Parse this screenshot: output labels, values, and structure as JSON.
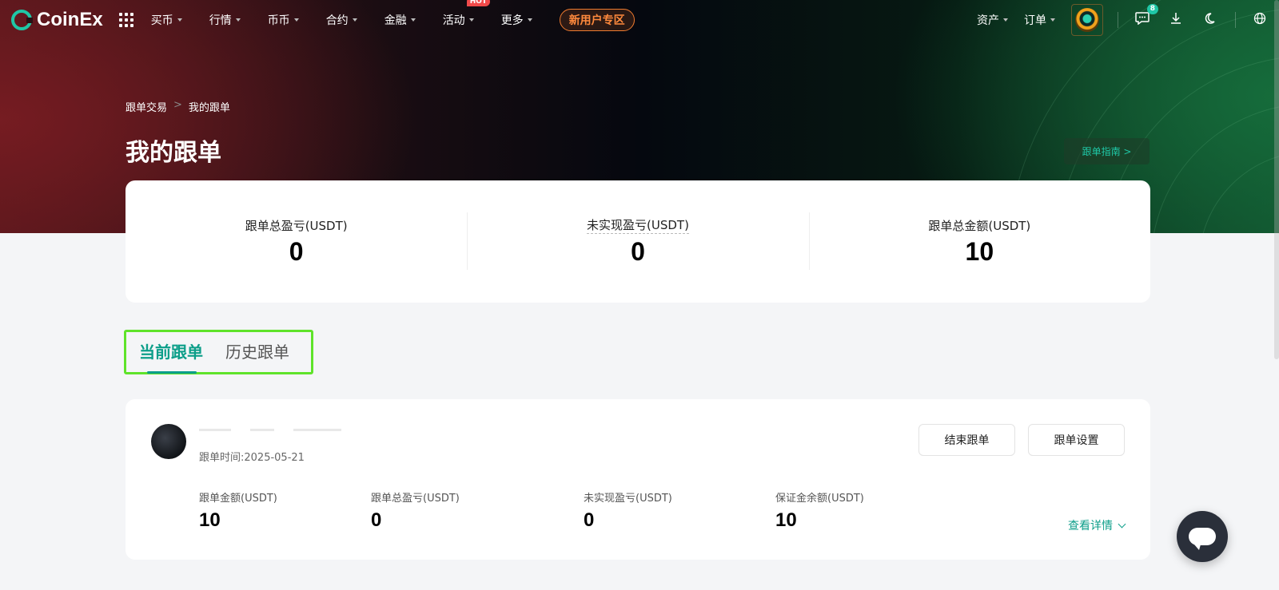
{
  "nav": {
    "brand": "CoinEx",
    "menu": [
      {
        "label": "买币",
        "has_caret": true
      },
      {
        "label": "行情",
        "has_caret": true
      },
      {
        "label": "币币",
        "has_caret": true
      },
      {
        "label": "合约",
        "has_caret": true
      },
      {
        "label": "金融",
        "has_caret": true
      },
      {
        "label": "活动",
        "has_caret": true,
        "badge": "HOT"
      },
      {
        "label": "更多",
        "has_caret": true
      }
    ],
    "promo_label": "新用户专区",
    "right": {
      "assets_label": "资产",
      "orders_label": "订单",
      "message_count": "8",
      "icons": [
        "message-icon",
        "download-icon",
        "moon-icon",
        "globe-icon"
      ]
    }
  },
  "header": {
    "breadcrumb": [
      "跟单交易",
      "我的跟单"
    ],
    "breadcrumb_separator": ">",
    "title": "我的跟单",
    "guide_link": "跟单指南 >"
  },
  "summary": [
    {
      "label": "跟单总盈亏(USDT)",
      "value": "0"
    },
    {
      "label": "未实现盈亏(USDT)",
      "value": "0"
    },
    {
      "label": "跟单总金额(USDT)",
      "value": "10"
    }
  ],
  "tabs": [
    {
      "label": "当前跟单",
      "active": true
    },
    {
      "label": "历史跟单",
      "active": false
    }
  ],
  "order": {
    "time": "跟单时间:2025-05-21",
    "end_button": "结束跟单",
    "settings_button": "跟单设置",
    "stats": [
      {
        "label": "跟单金额(USDT)",
        "value": "10"
      },
      {
        "label": "跟单总盈亏(USDT)",
        "value": "0"
      },
      {
        "label": "未实现盈亏(USDT)",
        "value": "0"
      },
      {
        "label": "保证金余额(USDT)",
        "value": "10"
      }
    ],
    "details_link": "查看详情"
  },
  "colors": {
    "accent": "#0c9e89",
    "promo": "#ff8a3d",
    "highlight_box": "#5fe32a"
  }
}
